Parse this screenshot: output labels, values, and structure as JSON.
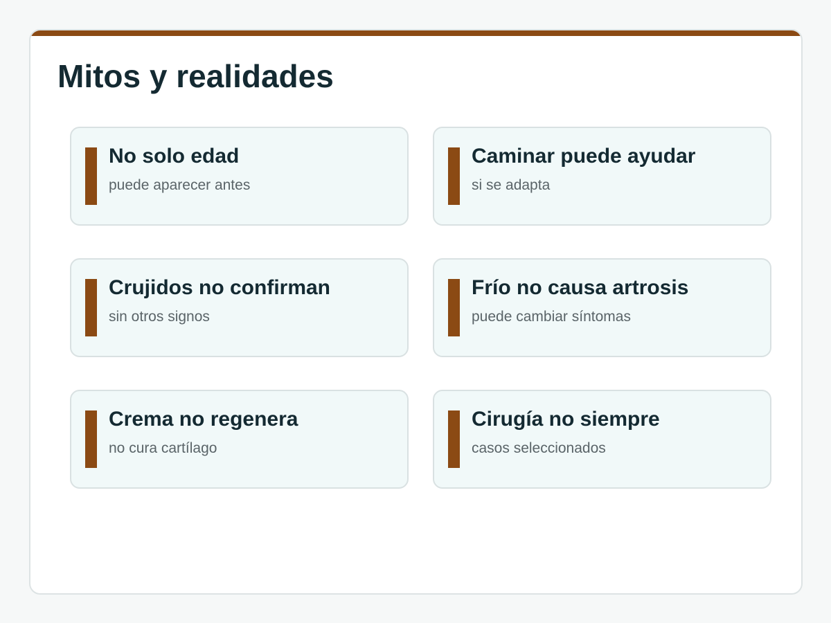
{
  "slide": {
    "title": "Mitos y realidades",
    "accent_color": "#8b4a14"
  },
  "cards": [
    {
      "title": "No solo edad",
      "subtitle": "puede aparecer antes"
    },
    {
      "title": "Caminar puede ayudar",
      "subtitle": "si se adapta"
    },
    {
      "title": "Crujidos no confirman",
      "subtitle": "sin otros signos"
    },
    {
      "title": "Frío no causa artrosis",
      "subtitle": "puede cambiar síntomas"
    },
    {
      "title": "Crema no regenera",
      "subtitle": "no cura cartílago"
    },
    {
      "title": "Cirugía no siempre",
      "subtitle": "casos seleccionados"
    }
  ]
}
